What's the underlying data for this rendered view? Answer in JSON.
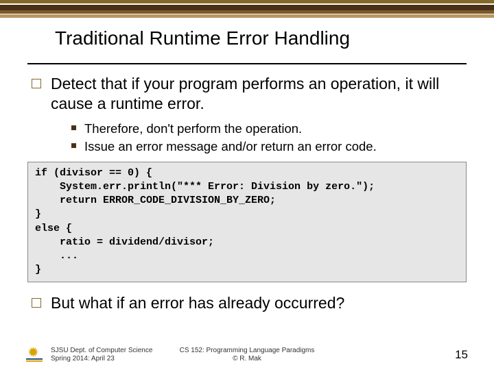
{
  "title": "Traditional Runtime Error Handling",
  "bullets": {
    "b1": "Detect that if your program performs an operation, it will cause a runtime error.",
    "b1_sub1": "Therefore, don't perform the operation.",
    "b1_sub2": "Issue an error message and/or return an error code.",
    "b2": "But what if an error has already occurred?"
  },
  "code": "if (divisor == 0) {\n    System.err.println(\"*** Error: Division by zero.\");\n    return ERROR_CODE_DIVISION_BY_ZERO;\n}\nelse {\n    ratio = dividend/divisor;\n    ...\n}",
  "footer": {
    "left_line1": "SJSU Dept. of Computer Science",
    "left_line2": "Spring 2014: April 23",
    "center_line1": "CS 152: Programming Language Paradigms",
    "center_line2": "© R. Mak",
    "page": "15"
  }
}
